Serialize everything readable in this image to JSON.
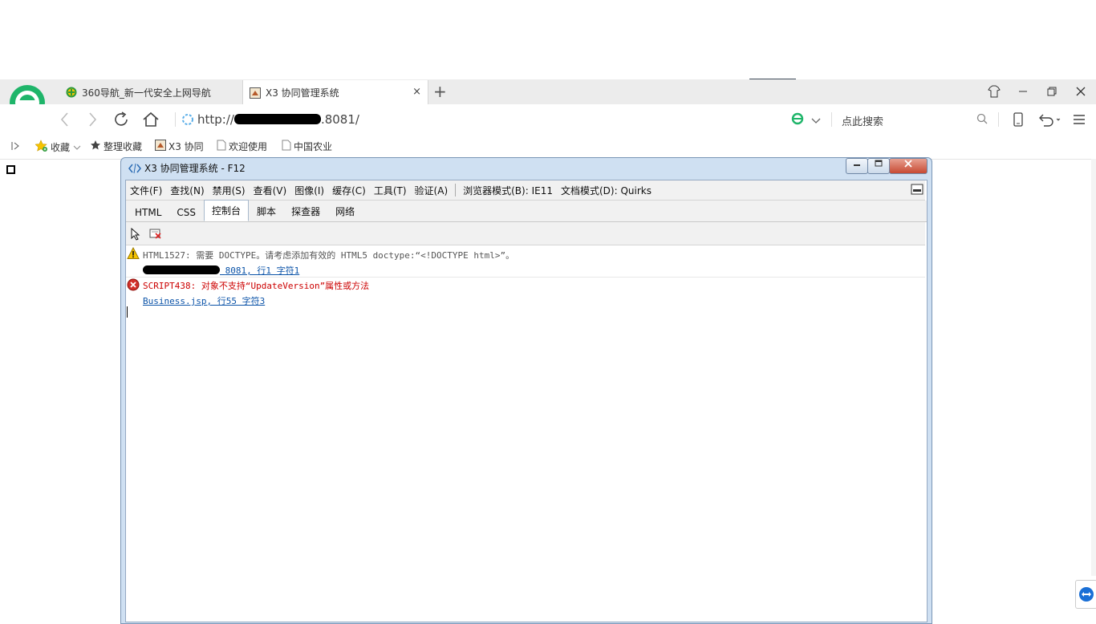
{
  "browser": {
    "tabs": [
      {
        "label": "360导航_新一代安全上网导航"
      },
      {
        "label": "X3 协同管理系统",
        "close": "×"
      }
    ],
    "new_tab": "+",
    "url": "http://",
    "url_suffix": ".8081/",
    "search_placeholder": "点此搜索",
    "favorites": [
      {
        "label": "收藏"
      },
      {
        "label": "整理收藏"
      },
      {
        "label": "X3 协同"
      },
      {
        "label": "欢迎使用"
      },
      {
        "label": "中国农业"
      }
    ]
  },
  "devtools": {
    "title": "X3 协同管理系统 - F12",
    "menu": [
      "文件(F)",
      "查找(N)",
      "禁用(S)",
      "查看(V)",
      "图像(I)",
      "缓存(C)",
      "工具(T)",
      "验证(A)"
    ],
    "browser_mode": "浏览器模式(B): IE11",
    "document_mode": "文档模式(D): Quirks",
    "tabs": [
      "HTML",
      "CSS",
      "控制台",
      "脚本",
      "探查器",
      "网络"
    ],
    "active_tab": "控制台",
    "console": [
      {
        "severity": "warning",
        "message": "HTML1527: 需要 DOCTYPE。请考虑添加有效的 HTML5 doctype:“<!DOCTYPE html>”。",
        "link": "8081, 行1 字符1"
      },
      {
        "severity": "error",
        "message": "SCRIPT438: 对象不支持“UpdateVersion”属性或方法",
        "link": "Business.jsp, 行55 字符3"
      }
    ]
  },
  "colors": {
    "accent_green": "#1fb56a",
    "error_red": "#cc0000",
    "link_blue": "#0b53a8"
  }
}
